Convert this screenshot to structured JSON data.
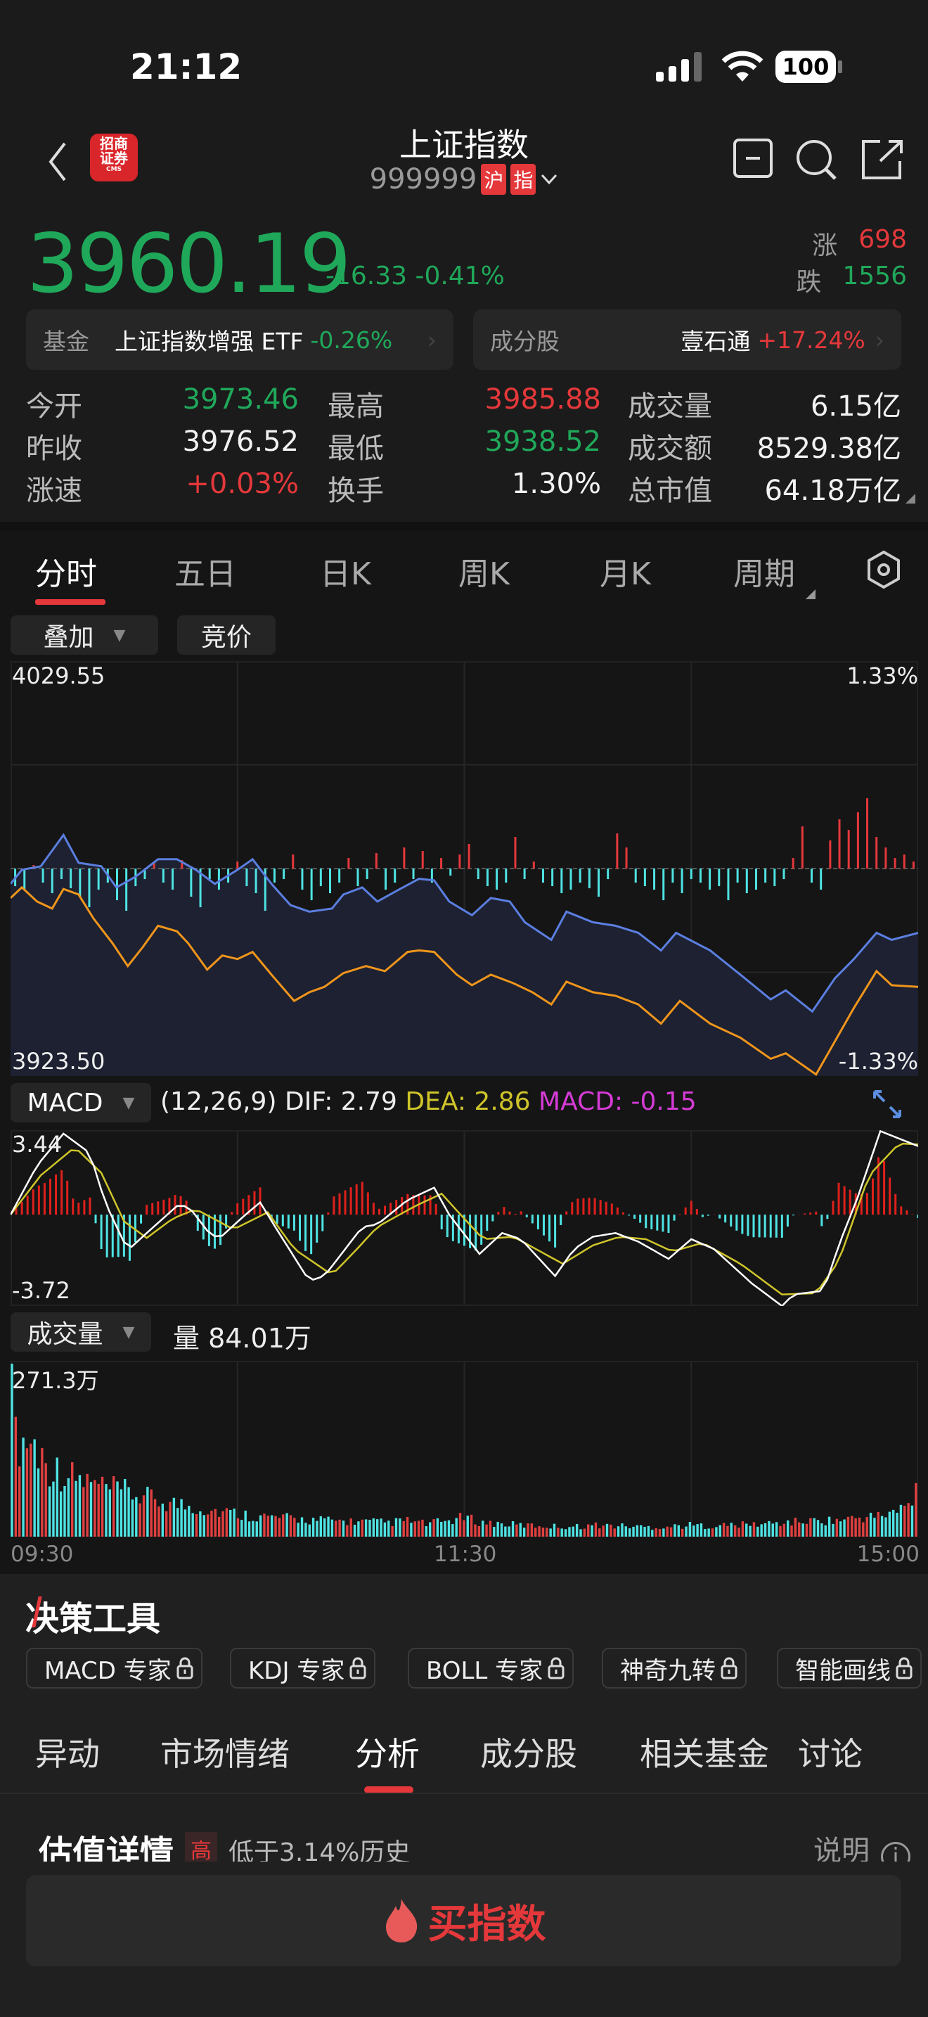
{
  "status": {
    "time": "21:12",
    "battery": "100"
  },
  "header": {
    "title": "上证指数",
    "code": "999999",
    "badges": [
      "沪",
      "指"
    ],
    "logo_text": "招商证券",
    "logo_sub": "CMS"
  },
  "quote": {
    "price": "3960.19",
    "change": "-16.33",
    "change_pct": "-0.41%",
    "up_label": "涨",
    "up_count": "698",
    "down_label": "跌",
    "down_count": "1556"
  },
  "cards": [
    {
      "label": "基金",
      "name": "上证指数增强 ETF",
      "value": "-0.26%"
    },
    {
      "label": "成分股",
      "name": "壹石通",
      "value": "+17.24%"
    }
  ],
  "stats": [
    [
      {
        "label": "今开",
        "value": "3973.46",
        "color": "green"
      },
      {
        "label": "最高",
        "value": "3985.88",
        "color": "red"
      },
      {
        "label": "成交量",
        "value": "6.15亿",
        "color": "white"
      }
    ],
    [
      {
        "label": "昨收",
        "value": "3976.52",
        "color": "white"
      },
      {
        "label": "最低",
        "value": "3938.52",
        "color": "green"
      },
      {
        "label": "成交额",
        "value": "8529.38亿",
        "color": "white"
      }
    ],
    [
      {
        "label": "涨速",
        "value": "+0.03%",
        "color": "red"
      },
      {
        "label": "换手",
        "value": "1.30%",
        "color": "white"
      },
      {
        "label": "总市值",
        "value": "64.18万亿",
        "color": "white"
      }
    ]
  ],
  "period_tabs": [
    "分时",
    "五日",
    "日K",
    "周K",
    "月K",
    "周期"
  ],
  "chart_buttons": {
    "overlay": "叠加",
    "auction": "竞价"
  },
  "chart_data": [
    {
      "type": "line",
      "name": "intraday",
      "ylim": [
        3923.5,
        4029.55
      ],
      "prev_close": 3976.52,
      "y_top_label": "4029.55",
      "y_bottom_label": "3923.50",
      "pct_top_label": "1.33%",
      "pct_bottom_label": "-1.33%",
      "x_labels": [
        "09:30",
        "11:30",
        "15:00"
      ],
      "price_line": [
        [
          0,
          3972.6
        ],
        [
          3,
          3976.2
        ],
        [
          8,
          3977.1
        ],
        [
          14,
          3985.1
        ],
        [
          18,
          3978.0
        ],
        [
          24,
          3977.1
        ],
        [
          28,
          3971.7
        ],
        [
          33,
          3974.4
        ],
        [
          39,
          3978.9
        ],
        [
          44,
          3978.9
        ],
        [
          49,
          3976.2
        ],
        [
          54,
          3972.6
        ],
        [
          60,
          3976.2
        ],
        [
          64,
          3978.9
        ],
        [
          69,
          3972.6
        ],
        [
          74,
          3967.2
        ],
        [
          79,
          3965.5
        ],
        [
          85,
          3966.3
        ],
        [
          88,
          3969.9
        ],
        [
          93,
          3971.7
        ],
        [
          97,
          3968.1
        ],
        [
          102,
          3970.8
        ],
        [
          108,
          3973.9
        ],
        [
          112,
          3973.5
        ],
        [
          116,
          3968.1
        ],
        [
          122,
          3964.6
        ],
        [
          127,
          3969.0
        ],
        [
          132,
          3968.1
        ],
        [
          136,
          3962.8
        ],
        [
          143,
          3958.3
        ],
        [
          147,
          3965.5
        ],
        [
          154,
          3962.8
        ],
        [
          160,
          3961.9
        ],
        [
          166,
          3960.1
        ],
        [
          172,
          3955.6
        ],
        [
          176,
          3960.1
        ],
        [
          185,
          3955.6
        ],
        [
          193,
          3949.4
        ],
        [
          201,
          3943.1
        ],
        [
          205,
          3945.4
        ],
        [
          212,
          3940.0
        ],
        [
          218,
          3948.5
        ],
        [
          223,
          3953.4
        ],
        [
          229,
          3960.1
        ],
        [
          233,
          3958.3
        ],
        [
          240,
          3960.1
        ]
      ],
      "overlay_line": [
        [
          0,
          3969.0
        ],
        [
          3,
          3971.7
        ],
        [
          7,
          3968.1
        ],
        [
          11,
          3966.3
        ],
        [
          14,
          3971.3
        ],
        [
          18,
          3969.9
        ],
        [
          22,
          3963.7
        ],
        [
          27,
          3957.4
        ],
        [
          31,
          3951.6
        ],
        [
          35,
          3956.5
        ],
        [
          39,
          3961.9
        ],
        [
          44,
          3960.5
        ],
        [
          47,
          3957.4
        ],
        [
          52,
          3950.7
        ],
        [
          56,
          3954.3
        ],
        [
          60,
          3953.4
        ],
        [
          64,
          3955.2
        ],
        [
          69,
          3949.4
        ],
        [
          75,
          3942.7
        ],
        [
          79,
          3944.9
        ],
        [
          83,
          3946.3
        ],
        [
          88,
          3949.8
        ],
        [
          94,
          3951.6
        ],
        [
          99,
          3950.3
        ],
        [
          105,
          3955.2
        ],
        [
          108,
          3955.6
        ],
        [
          112,
          3955.2
        ],
        [
          118,
          3949.4
        ],
        [
          122,
          3946.7
        ],
        [
          127,
          3949.4
        ],
        [
          133,
          3947.2
        ],
        [
          138,
          3944.9
        ],
        [
          143,
          3941.8
        ],
        [
          147,
          3947.6
        ],
        [
          154,
          3944.9
        ],
        [
          160,
          3944.0
        ],
        [
          166,
          3941.8
        ],
        [
          172,
          3936.9
        ],
        [
          177,
          3942.7
        ],
        [
          185,
          3936.9
        ],
        [
          193,
          3933.3
        ],
        [
          201,
          3927.9
        ],
        [
          205,
          3929.3
        ],
        [
          213,
          3923.9
        ],
        [
          218,
          3932.4
        ],
        [
          223,
          3940.9
        ],
        [
          229,
          3950.3
        ],
        [
          233,
          3946.7
        ],
        [
          240,
          3946.3
        ]
      ],
      "strength_bars": [
        -25,
        -30,
        5,
        -20,
        -35,
        -15,
        -28,
        -40,
        -55,
        -30,
        -20,
        -45,
        -60,
        -25,
        -15,
        8,
        -20,
        -30,
        12,
        -40,
        -55,
        -15,
        -30,
        -20,
        10,
        -25,
        -35,
        -60,
        -20,
        -15,
        20,
        -30,
        -45,
        -25,
        -35,
        -20,
        15,
        -25,
        -15,
        22,
        -30,
        -20,
        30,
        -15,
        25,
        -20,
        15,
        -10,
        20,
        35,
        -15,
        -25,
        -30,
        -20,
        45,
        -15,
        10,
        -20,
        -25,
        -35,
        -30,
        -20,
        -28,
        -40,
        -15,
        50,
        30,
        -20,
        -25,
        -30,
        -45,
        -20,
        -35,
        -15,
        -20,
        -30,
        -25,
        -45,
        -20,
        -35,
        -30,
        -20,
        -25,
        -15,
        15,
        60,
        -20,
        -30,
        40,
        70,
        55,
        80,
        100,
        45,
        30,
        15,
        20,
        10
      ]
    },
    {
      "type": "line",
      "name": "MACD",
      "params": "(12,26,9)",
      "dif_label": "DIF: 2.79",
      "dea_label": "DEA: 2.86",
      "macd_label": "MACD: -0.15",
      "ylim": [
        -3.72,
        3.44
      ],
      "y_top_label": "3.44",
      "y_bottom_label": "-3.72",
      "dif": [
        [
          0,
          0
        ],
        [
          7,
          2.0
        ],
        [
          14,
          3.3
        ],
        [
          21,
          2.5
        ],
        [
          25,
          0.5
        ],
        [
          31,
          -1.45
        ],
        [
          36,
          -0.75
        ],
        [
          44,
          0.35
        ],
        [
          47,
          0.35
        ],
        [
          52,
          -0.65
        ],
        [
          55,
          -1.0
        ],
        [
          61,
          -0.15
        ],
        [
          66,
          0.5
        ],
        [
          71,
          -0.75
        ],
        [
          79,
          -2.7
        ],
        [
          83,
          -2.5
        ],
        [
          88,
          -1.5
        ],
        [
          93,
          -0.5
        ],
        [
          97,
          -0.4
        ],
        [
          105,
          0.6
        ],
        [
          112,
          1.1
        ],
        [
          116,
          0
        ],
        [
          124,
          -1.6
        ],
        [
          130,
          -0.75
        ],
        [
          135,
          -1.0
        ],
        [
          144,
          -2.5
        ],
        [
          149,
          -1.4
        ],
        [
          154,
          -0.9
        ],
        [
          160,
          -0.75
        ],
        [
          166,
          -1.1
        ],
        [
          174,
          -1.8
        ],
        [
          180,
          -1.0
        ],
        [
          186,
          -1.4
        ],
        [
          196,
          -2.8
        ],
        [
          204,
          -3.72
        ],
        [
          207,
          -3.25
        ],
        [
          215,
          -3.1
        ],
        [
          219,
          -1.25
        ],
        [
          224,
          0.7
        ],
        [
          230,
          3.4
        ],
        [
          240,
          2.79
        ]
      ],
      "dea": [
        [
          0,
          0
        ],
        [
          8,
          1.6
        ],
        [
          17,
          2.75
        ],
        [
          24,
          1.7
        ],
        [
          30,
          -0.27
        ],
        [
          36,
          -0.95
        ],
        [
          43,
          -0.15
        ],
        [
          49,
          0.22
        ],
        [
          59,
          -0.6
        ],
        [
          68,
          0.1
        ],
        [
          75,
          -1.4
        ],
        [
          85,
          -2.45
        ],
        [
          91,
          -1.5
        ],
        [
          97,
          -0.5
        ],
        [
          107,
          0.35
        ],
        [
          114,
          0.85
        ],
        [
          119,
          0
        ],
        [
          125,
          -1.0
        ],
        [
          133,
          -0.9
        ],
        [
          146,
          -2.0
        ],
        [
          154,
          -1.25
        ],
        [
          161,
          -0.9
        ],
        [
          168,
          -1.0
        ],
        [
          175,
          -1.5
        ],
        [
          183,
          -1.15
        ],
        [
          193,
          -2.0
        ],
        [
          204,
          -3.25
        ],
        [
          213,
          -3.2
        ],
        [
          219,
          -1.9
        ],
        [
          227,
          1.6
        ],
        [
          235,
          2.9
        ],
        [
          240,
          2.86
        ]
      ]
    },
    {
      "type": "bar",
      "name": "volume",
      "label": "成交量",
      "current_label": "量 84.01万",
      "y_top_label": "271.3万",
      "ymax": 271.3,
      "unit": "万",
      "last_value": 84.01,
      "envelope_every_5min": [
        271.3,
        150,
        110,
        95,
        85,
        75,
        70,
        62,
        55,
        50,
        45,
        40,
        36,
        32,
        30,
        28,
        26,
        25,
        24,
        23,
        22,
        25,
        20,
        24,
        30,
        22,
        20,
        18,
        17,
        16,
        16,
        18,
        17,
        16,
        15,
        16,
        18,
        17,
        18,
        19,
        20,
        22,
        24,
        25,
        26,
        30,
        32,
        40,
        55
      ]
    }
  ],
  "tools": {
    "title": "决策工具",
    "chips": [
      "MACD 专家",
      "KDJ 专家",
      "BOLL 专家",
      "神奇九转",
      "智能画线"
    ]
  },
  "bottom_tabs": [
    "异动",
    "市场情绪",
    "分析",
    "成分股",
    "相关基金",
    "讨论"
  ],
  "valuation": {
    "title": "估值详情",
    "badge": "高",
    "desc": "低于3.14%历史",
    "help": "说明"
  },
  "buy_button": "买指数",
  "colors": {
    "up": "#e5383b",
    "down": "#20a85a",
    "price_line": "#5b7fe0",
    "overlay_line": "#f0951c",
    "dif": "#ffffff",
    "dea": "#cfc52a",
    "macd": "#d63bd6",
    "cyan": "#4fe3e3"
  }
}
